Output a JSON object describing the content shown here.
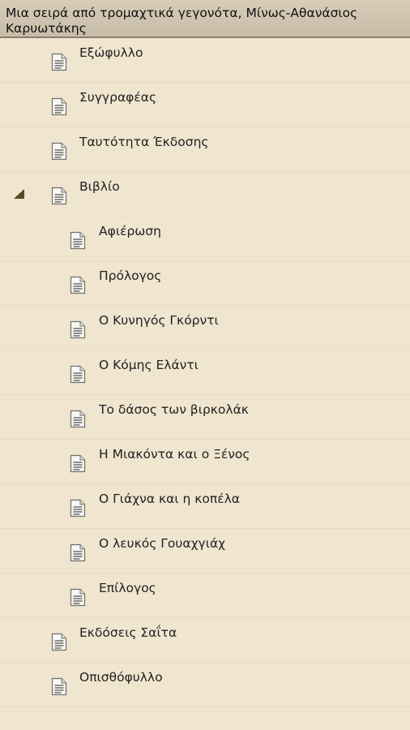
{
  "title": "Μια σειρά από τρομαχτικά γεγονότα, Μίνως-Αθανάσιος Καρυωτάκης",
  "toc": {
    "items": [
      {
        "label": "Εξώφυλλο",
        "icon": "document-icon"
      },
      {
        "label": "Συγγραφέας",
        "icon": "document-icon"
      },
      {
        "label": "Ταυτότητα Έκδοσης",
        "icon": "document-icon"
      },
      {
        "label": "Βιβλίο",
        "icon": "document-icon",
        "expanded": true
      },
      {
        "label": "Αφιέρωση",
        "icon": "document-icon"
      },
      {
        "label": "Πρόλογος",
        "icon": "document-icon"
      },
      {
        "label": "Ο Κυνηγός Γκόρντι",
        "icon": "document-icon"
      },
      {
        "label": "Ο Κόμης Ελάντι",
        "icon": "document-icon"
      },
      {
        "label": "Το δάσος των βιρκολάκ",
        "icon": "document-icon"
      },
      {
        "label": "Η Μιακόντα και ο Ξένος",
        "icon": "document-icon"
      },
      {
        "label": "Ο Γιάχνα και η κοπέλα",
        "icon": "document-icon"
      },
      {
        "label": "Ο λευκός Γουαχγιάχ",
        "icon": "document-icon"
      },
      {
        "label": "Επίλογος",
        "icon": "document-icon"
      },
      {
        "label": "Εκδόσεις Σαΐτα",
        "icon": "document-icon"
      },
      {
        "label": "Οπισθόφυλλο",
        "icon": "document-icon"
      }
    ]
  }
}
